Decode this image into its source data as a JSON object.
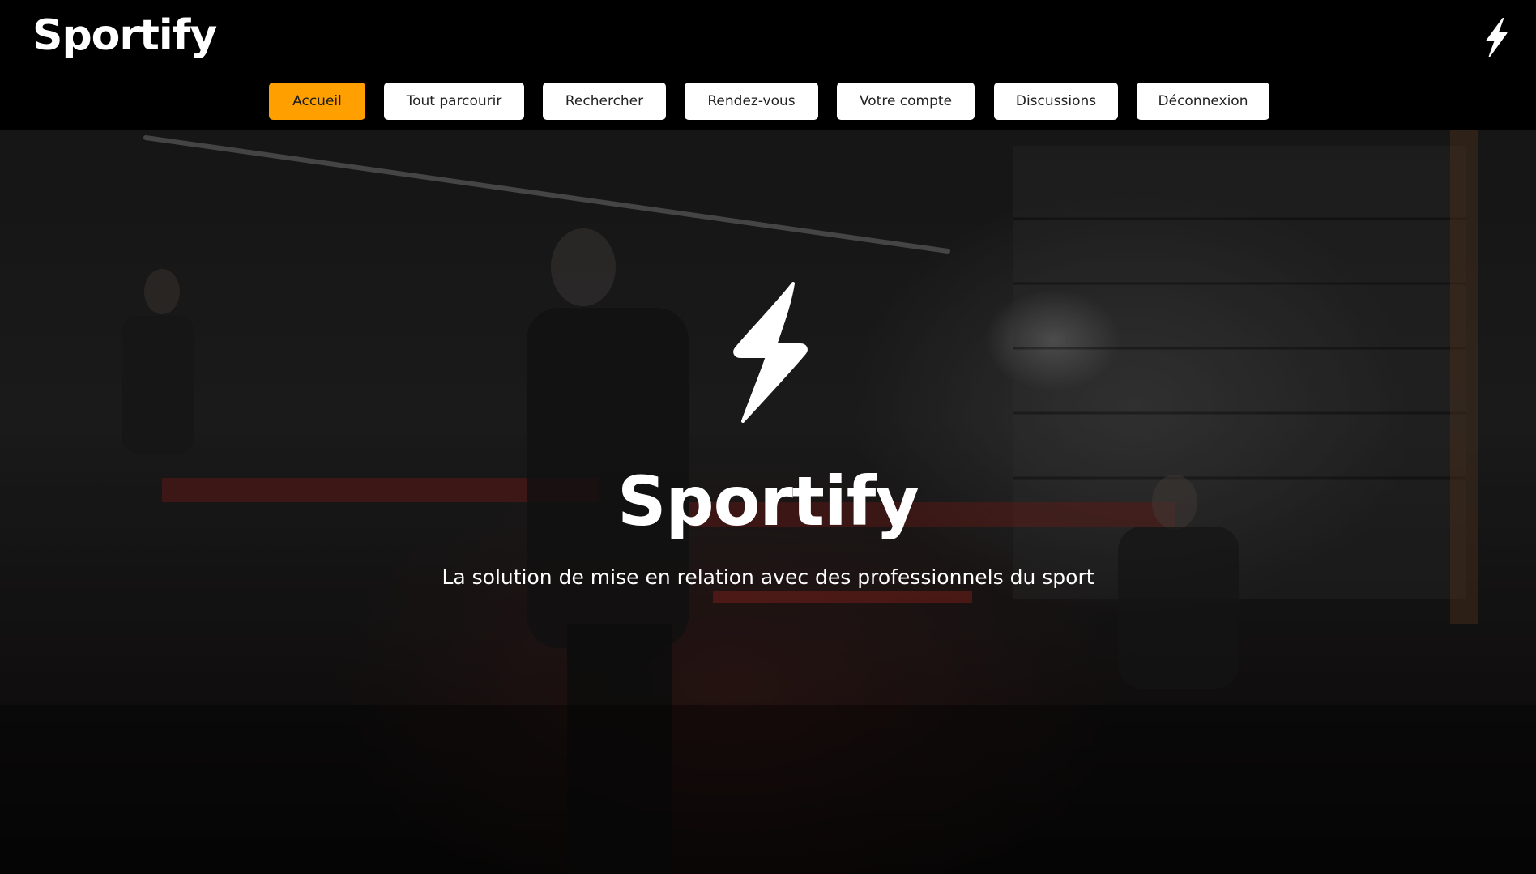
{
  "header": {
    "brand": "Sportify",
    "brand_icon": "lightning-bolt-icon"
  },
  "nav": {
    "items": [
      {
        "label": "Accueil",
        "active": true
      },
      {
        "label": "Tout parcourir",
        "active": false
      },
      {
        "label": "Rechercher",
        "active": false
      },
      {
        "label": "Rendez-vous",
        "active": false
      },
      {
        "label": "Votre compte",
        "active": false
      },
      {
        "label": "Discussions",
        "active": false
      },
      {
        "label": "Déconnexion",
        "active": false
      }
    ],
    "active_color": "#ffa000",
    "inactive_color": "#ffffff"
  },
  "hero": {
    "logo_icon": "lightning-bolt-icon",
    "title": "Sportify",
    "subtitle": "La solution de mise en relation avec des professionnels du sport"
  }
}
